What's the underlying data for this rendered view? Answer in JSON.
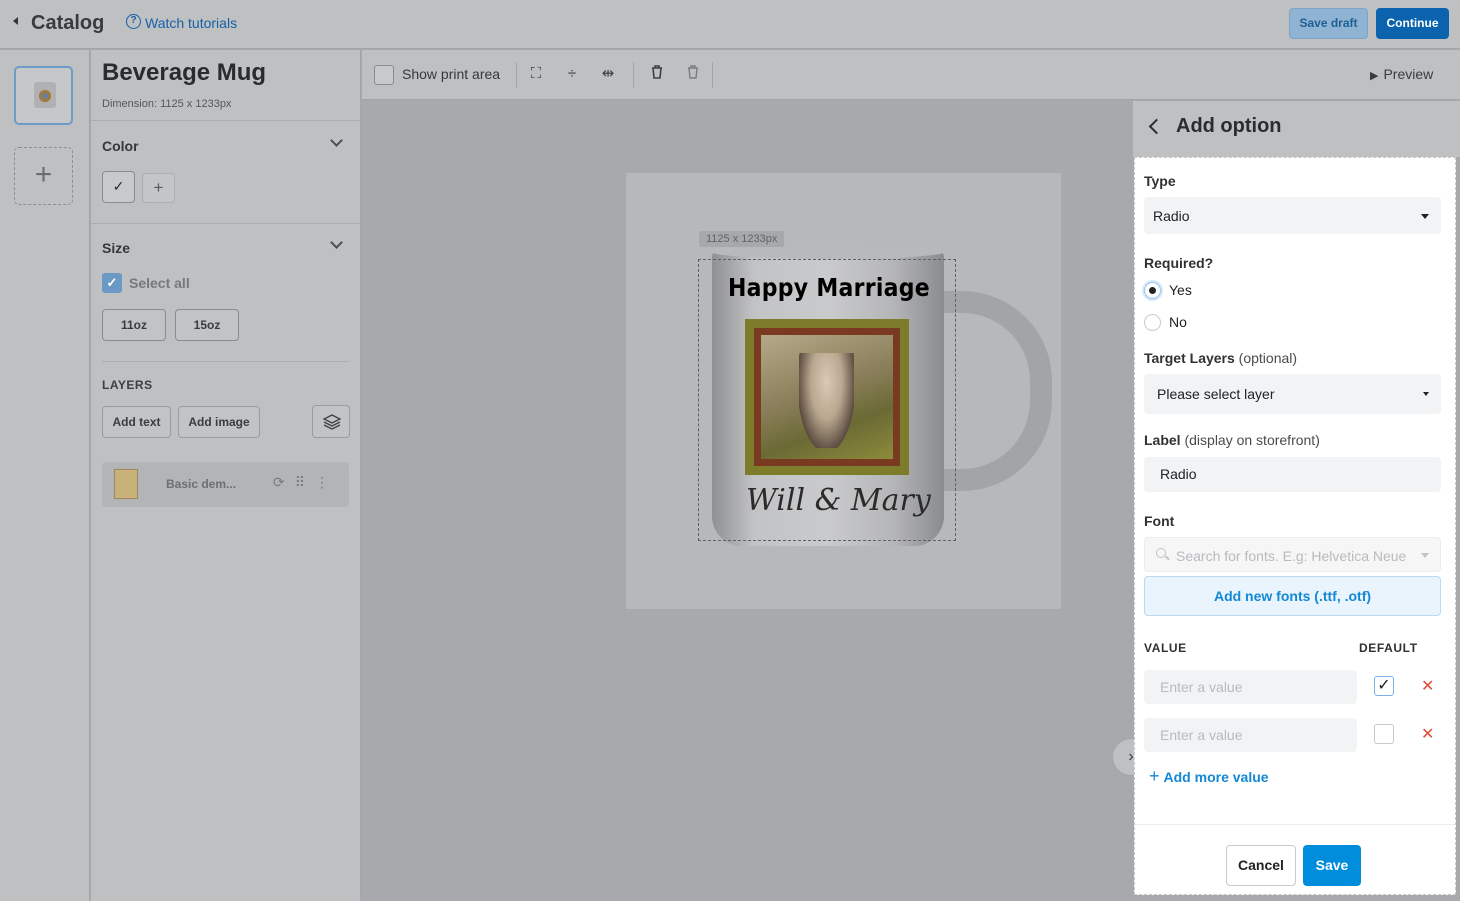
{
  "topbar": {
    "title": "Catalog",
    "tutorials": "Watch tutorials",
    "save_draft": "Save draft",
    "continue": "Continue"
  },
  "product": {
    "title": "Beverage Mug",
    "dimension": "Dimension: 1125 x 1233px",
    "color_label": "Color",
    "size_label": "Size",
    "select_all": "Select all",
    "sizes": [
      "11oz",
      "15oz"
    ],
    "layers_label": "LAYERS",
    "add_text": "Add text",
    "add_image": "Add image",
    "layer_name": "Basic dem..."
  },
  "toolbar": {
    "show_print_area": "Show print area",
    "preview": "Preview"
  },
  "canvas": {
    "dimension_tag": "1125 x 1233px",
    "mug_text": "Happy Marriage",
    "mug_script": "Will & Mary"
  },
  "option_panel": {
    "title": "Add option",
    "type_label": "Type",
    "type_value": "Radio",
    "required_label": "Required?",
    "required_yes": "Yes",
    "required_no": "No",
    "required_selected": "Yes",
    "target_layers_label": "Target Layers",
    "target_layers_hint": "(optional)",
    "target_layers_value": "Please select layer",
    "label_label": "Label",
    "label_hint": "(display on storefront)",
    "label_value": "Radio",
    "font_label": "Font",
    "font_placeholder": "Search for fonts. E.g: Helvetica Neue",
    "add_fonts": "Add new fonts (.ttf, .otf)",
    "value_header": "VALUE",
    "default_header": "DEFAULT",
    "value_placeholder": "Enter a value",
    "values": [
      {
        "value": "",
        "default": true
      },
      {
        "value": "",
        "default": false
      }
    ],
    "add_more": "Add more value",
    "cancel": "Cancel",
    "save": "Save"
  },
  "colors": {
    "primary": "#008ddb",
    "delete": "#e24c3a",
    "link": "#1388d6"
  }
}
